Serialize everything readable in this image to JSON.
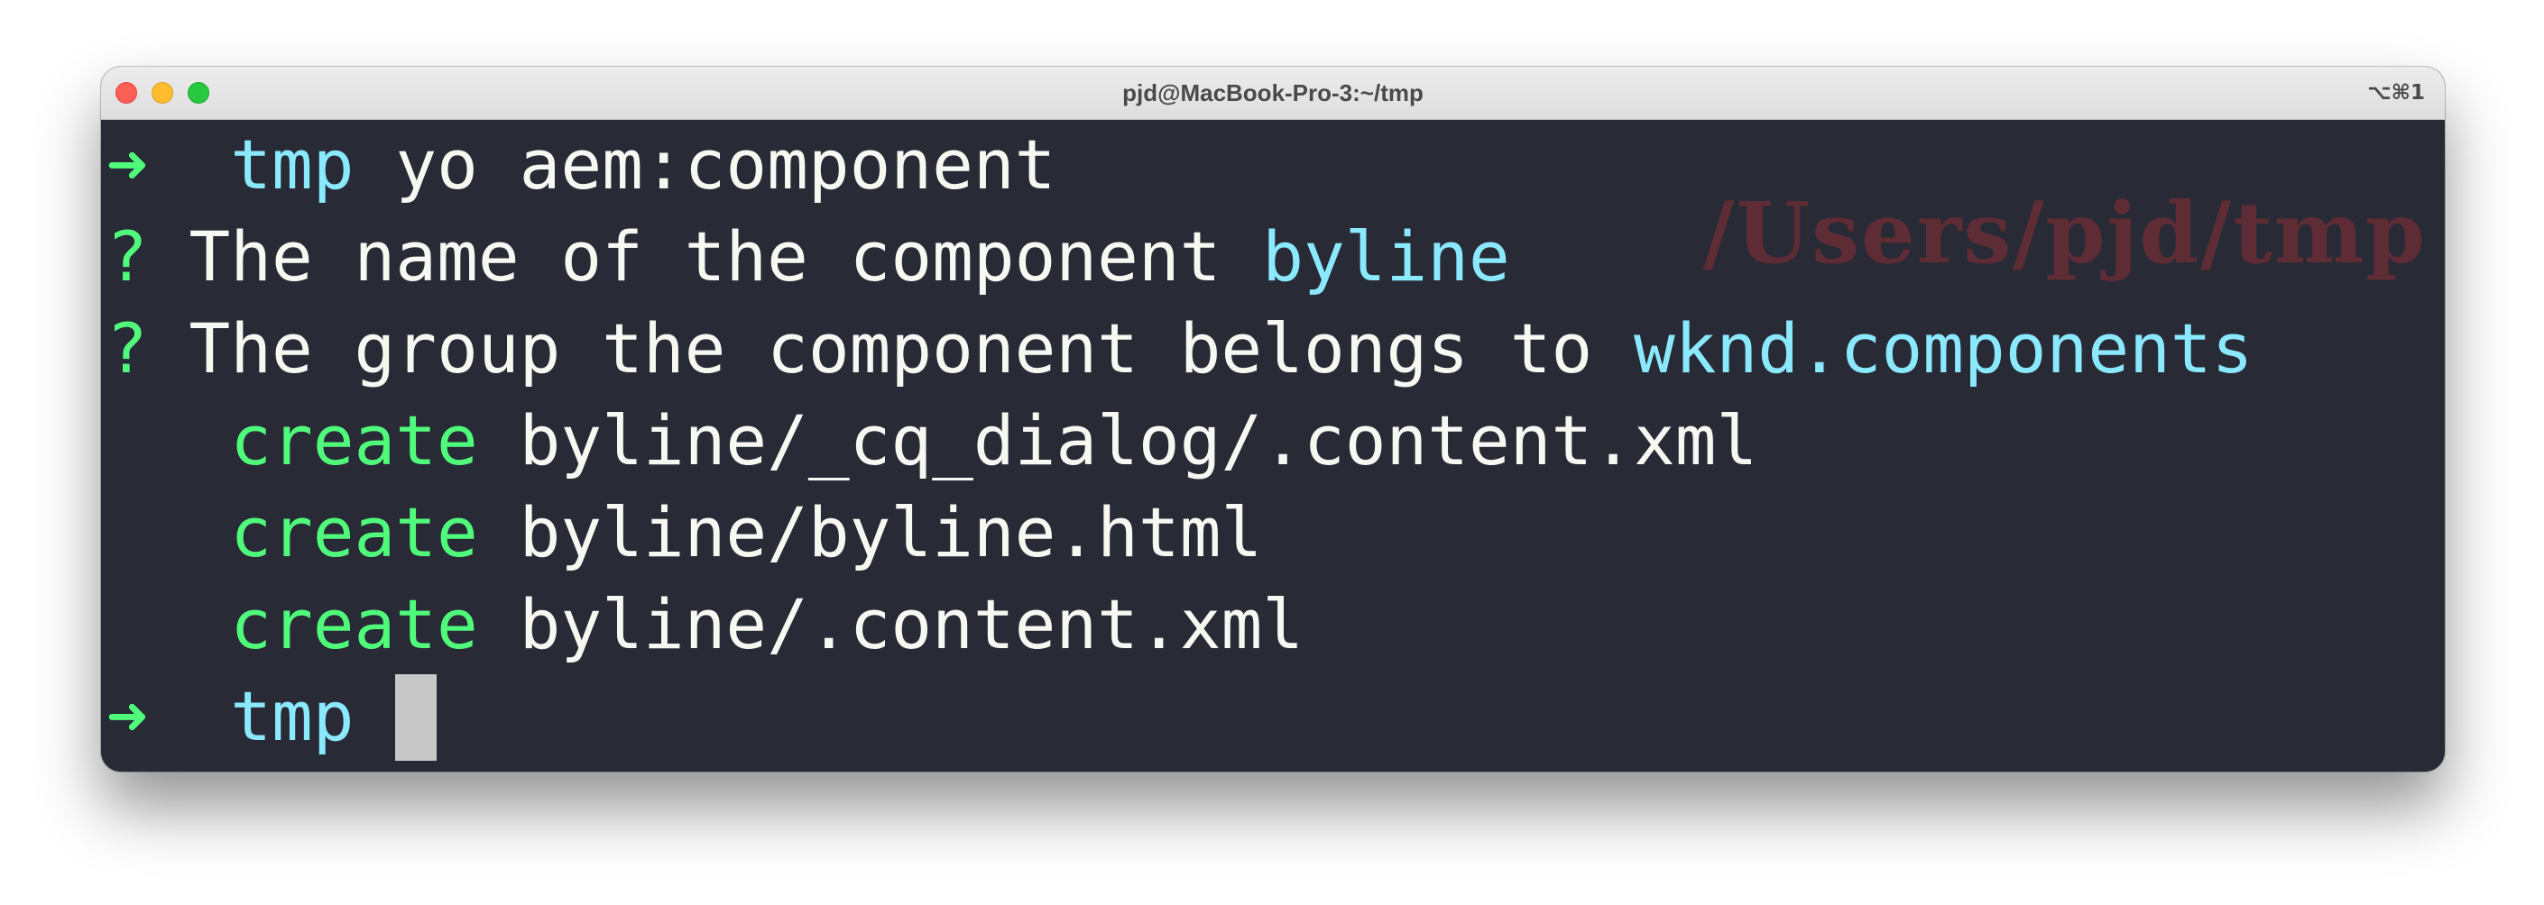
{
  "window": {
    "title": "pjd@MacBook-Pro-3:~/tmp",
    "shortcut": "⌥⌘1",
    "watermark": "/Users/pjd/tmp"
  },
  "terminal": {
    "prompt_arrow": "➜",
    "question_mark": "?",
    "lines": [
      {
        "dir": "tmp",
        "command": "yo aem:component"
      },
      {
        "question": "The name of the component",
        "answer": "byline"
      },
      {
        "question": "The group the component belongs to",
        "answer": "wknd.components"
      },
      {
        "action": "create",
        "path": "byline/_cq_dialog/.content.xml"
      },
      {
        "action": "create",
        "path": "byline/byline.html"
      },
      {
        "action": "create",
        "path": "byline/.content.xml"
      },
      {
        "dir": "tmp"
      }
    ]
  },
  "colors": {
    "background": "#282a36",
    "prompt_green": "#50fa7b",
    "dir_cyan": "#8be9fd",
    "text": "#f8f8f2",
    "watermark": "#5e2c34"
  }
}
